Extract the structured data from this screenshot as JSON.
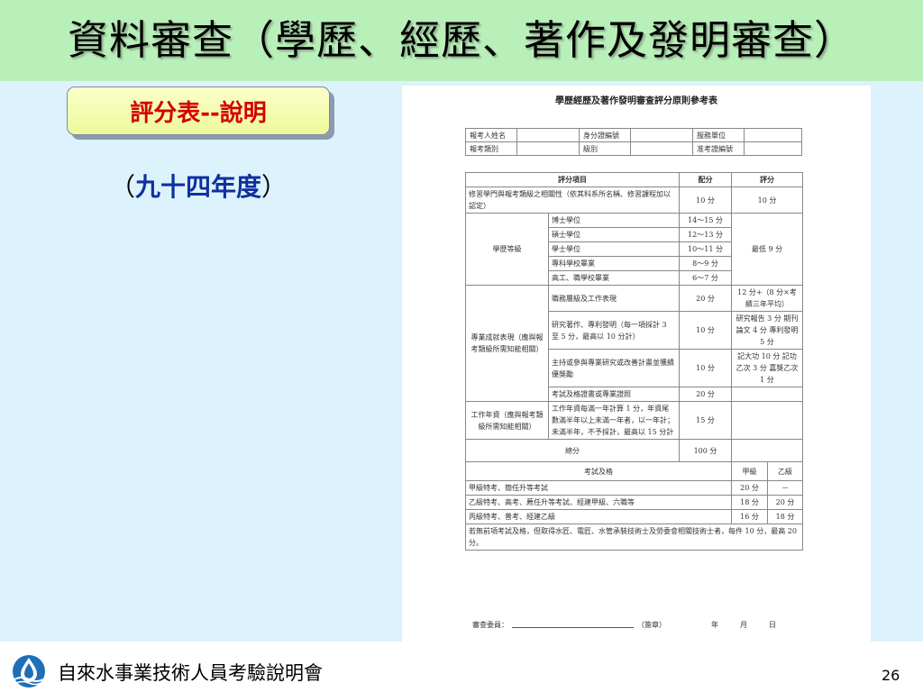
{
  "slide": {
    "title": "資料審查（學歷、經歷、著作及發明審查）",
    "subtitle_button": "評分表--說明",
    "year_open": "（",
    "year": "九十四年度",
    "year_close": "）",
    "footer": "自來水事業技術人員考驗說明會",
    "page_number": "26"
  },
  "document": {
    "title": "學歷經歷及著作發明審查評分原則參考表",
    "info": [
      [
        "報考人姓名",
        "",
        "身分證編號",
        "",
        "服務單位",
        ""
      ],
      [
        "報考類別",
        "",
        "級別",
        "",
        "准考證編號",
        ""
      ]
    ],
    "headers": {
      "item": "評分項目",
      "allot": "配分",
      "score": "評分"
    },
    "row_relevance": {
      "item": "修習學門與報考類級之相關性（依其科系所名稱、修習課程加以認定）",
      "allot": "10 分",
      "score": "10 分"
    },
    "education": {
      "label": "學歷等級",
      "min": "最低 9 分",
      "rows": [
        {
          "item": "博士學位",
          "allot": "14～15 分"
        },
        {
          "item": "碩士學位",
          "allot": "12～13 分"
        },
        {
          "item": "學士學位",
          "allot": "10～11 分"
        },
        {
          "item": "專科學校畢業",
          "allot": "8～9 分"
        },
        {
          "item": "高工、職學校畢業",
          "allot": "6～7 分"
        }
      ]
    },
    "achievement": {
      "label": "專業成就表現（應與報考類級所需知能相關）",
      "rows": [
        {
          "item": "職務層級及工作表現",
          "allot": "20 分",
          "score": "12 分+（8 分×考績三年平均）"
        },
        {
          "item": "研究著作、專利發明（每一項採計 3 至 5 分，最高以 10 分計）",
          "allot": "10 分",
          "score": "研究報告 3 分 期刊論文 4 分 專利發明 5 分"
        },
        {
          "item": "主持或參與專業研究或改善計畫並獲績優獎勵",
          "allot": "10 分",
          "score": "記大功 10 分 記功乙次 3 分 嘉獎乙次 1 分"
        },
        {
          "item": "考試及格證書或專業證照",
          "allot": "20 分",
          "score": ""
        }
      ]
    },
    "experience": {
      "label": "工作年資（應與報考類級所需知能相關）",
      "item": "工作年資每滿一年計算 1 分，年資尾數滿半年以上未滿一年者，以一年計；未滿半年，不予採計，最高以 15 分計",
      "allot": "15 分"
    },
    "total": {
      "label": "總分",
      "allot": "100 分"
    },
    "exam": {
      "header": "考試及格",
      "grade_a": "甲級",
      "grade_b": "乙級",
      "rows": [
        {
          "item": "甲級特考、簡任升等考試",
          "a": "20 分",
          "b": "－"
        },
        {
          "item": "乙級特考、高考、薦任升等考試、經建甲級、六職等",
          "a": "18 分",
          "b": "20 分"
        },
        {
          "item": "丙級特考、普考、經建乙級",
          "a": "16 分",
          "b": "18 分"
        }
      ],
      "note": "若無前項考試及格，但取得水匠、電匠、水管承裝技術士及勞委會相關技術士者，每件 10 分，最高 20 分。"
    },
    "sign": {
      "label": "審查委員：",
      "stamp": "（簽章）",
      "year": "年",
      "month": "月",
      "day": "日"
    }
  },
  "colors": {
    "title_bar": "#b9f0b9",
    "content_bg": "#dcf3fd",
    "button_text": "#d40000",
    "year_text": "#1030a0"
  }
}
